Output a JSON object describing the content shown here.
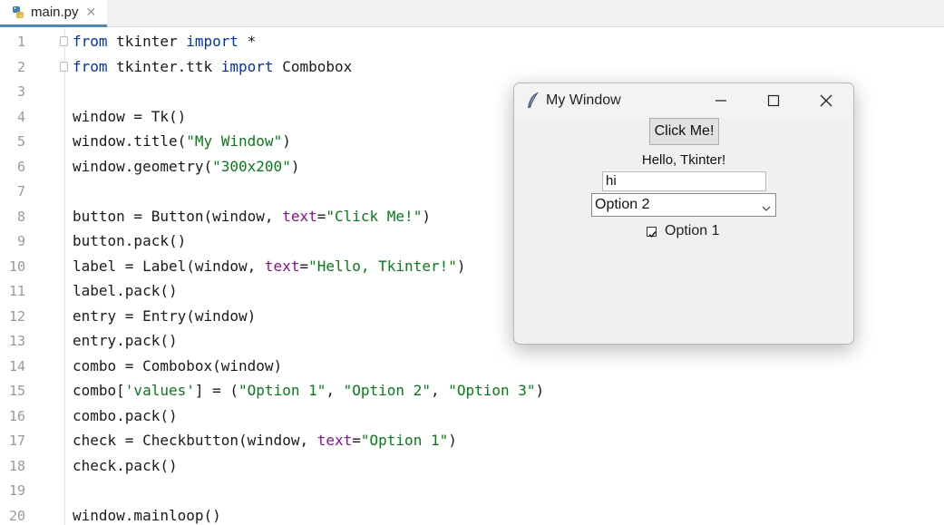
{
  "editor": {
    "tab": {
      "filename": "main.py",
      "close_glyph": "✕"
    },
    "lines": [
      {
        "n": "1",
        "tokens": [
          {
            "t": "from",
            "c": "kw"
          },
          {
            "t": " tkinter ",
            "c": ""
          },
          {
            "t": "import",
            "c": "kw"
          },
          {
            "t": " *",
            "c": ""
          }
        ]
      },
      {
        "n": "2",
        "tokens": [
          {
            "t": "from",
            "c": "kw"
          },
          {
            "t": " tkinter.ttk ",
            "c": ""
          },
          {
            "t": "import",
            "c": "kw"
          },
          {
            "t": " Combobox",
            "c": ""
          }
        ]
      },
      {
        "n": "3",
        "tokens": []
      },
      {
        "n": "4",
        "tokens": [
          {
            "t": "window = Tk()",
            "c": ""
          }
        ]
      },
      {
        "n": "5",
        "tokens": [
          {
            "t": "window.title(",
            "c": ""
          },
          {
            "t": "\"My Window\"",
            "c": "str"
          },
          {
            "t": ")",
            "c": ""
          }
        ]
      },
      {
        "n": "6",
        "tokens": [
          {
            "t": "window.geometry(",
            "c": ""
          },
          {
            "t": "\"300x200\"",
            "c": "str"
          },
          {
            "t": ")",
            "c": ""
          }
        ]
      },
      {
        "n": "7",
        "tokens": []
      },
      {
        "n": "8",
        "tokens": [
          {
            "t": "button = Button(window, ",
            "c": ""
          },
          {
            "t": "text",
            "c": "param"
          },
          {
            "t": "=",
            "c": ""
          },
          {
            "t": "\"Click Me!\"",
            "c": "str"
          },
          {
            "t": ")",
            "c": ""
          }
        ]
      },
      {
        "n": "9",
        "tokens": [
          {
            "t": "button.pack()",
            "c": ""
          }
        ]
      },
      {
        "n": "10",
        "tokens": [
          {
            "t": "label = Label(window, ",
            "c": ""
          },
          {
            "t": "text",
            "c": "param"
          },
          {
            "t": "=",
            "c": ""
          },
          {
            "t": "\"Hello, Tkinter!\"",
            "c": "str"
          },
          {
            "t": ")",
            "c": ""
          }
        ]
      },
      {
        "n": "11",
        "tokens": [
          {
            "t": "label.pack()",
            "c": ""
          }
        ]
      },
      {
        "n": "12",
        "tokens": [
          {
            "t": "entry = Entry(window)",
            "c": ""
          }
        ]
      },
      {
        "n": "13",
        "tokens": [
          {
            "t": "entry.pack()",
            "c": ""
          }
        ]
      },
      {
        "n": "14",
        "tokens": [
          {
            "t": "combo = Combobox(window)",
            "c": ""
          }
        ]
      },
      {
        "n": "15",
        "tokens": [
          {
            "t": "combo[",
            "c": ""
          },
          {
            "t": "'values'",
            "c": "str"
          },
          {
            "t": "] = (",
            "c": ""
          },
          {
            "t": "\"Option 1\"",
            "c": "str"
          },
          {
            "t": ", ",
            "c": ""
          },
          {
            "t": "\"Option 2\"",
            "c": "str"
          },
          {
            "t": ", ",
            "c": ""
          },
          {
            "t": "\"Option 3\"",
            "c": "str"
          },
          {
            "t": ")",
            "c": ""
          }
        ]
      },
      {
        "n": "16",
        "tokens": [
          {
            "t": "combo.pack()",
            "c": ""
          }
        ]
      },
      {
        "n": "17",
        "tokens": [
          {
            "t": "check = Checkbutton(window, ",
            "c": ""
          },
          {
            "t": "text",
            "c": "param"
          },
          {
            "t": "=",
            "c": ""
          },
          {
            "t": "\"Option 1\"",
            "c": "str"
          },
          {
            "t": ")",
            "c": ""
          }
        ]
      },
      {
        "n": "18",
        "tokens": [
          {
            "t": "check.pack()",
            "c": ""
          }
        ]
      },
      {
        "n": "19",
        "tokens": []
      },
      {
        "n": "20",
        "tokens": [
          {
            "t": "window.mainloop()",
            "c": ""
          }
        ]
      }
    ]
  },
  "tk_window": {
    "title": "My Window",
    "button_label": "Click Me!",
    "label_text": "Hello, Tkinter!",
    "entry_value": "hi",
    "combo_selected": "Option 2",
    "check_label": "Option 1",
    "check_checked": true
  },
  "colors": {
    "keyword": "#0033b3",
    "string": "#067d17",
    "param": "#871094",
    "tab_accent": "#4a88c7"
  }
}
